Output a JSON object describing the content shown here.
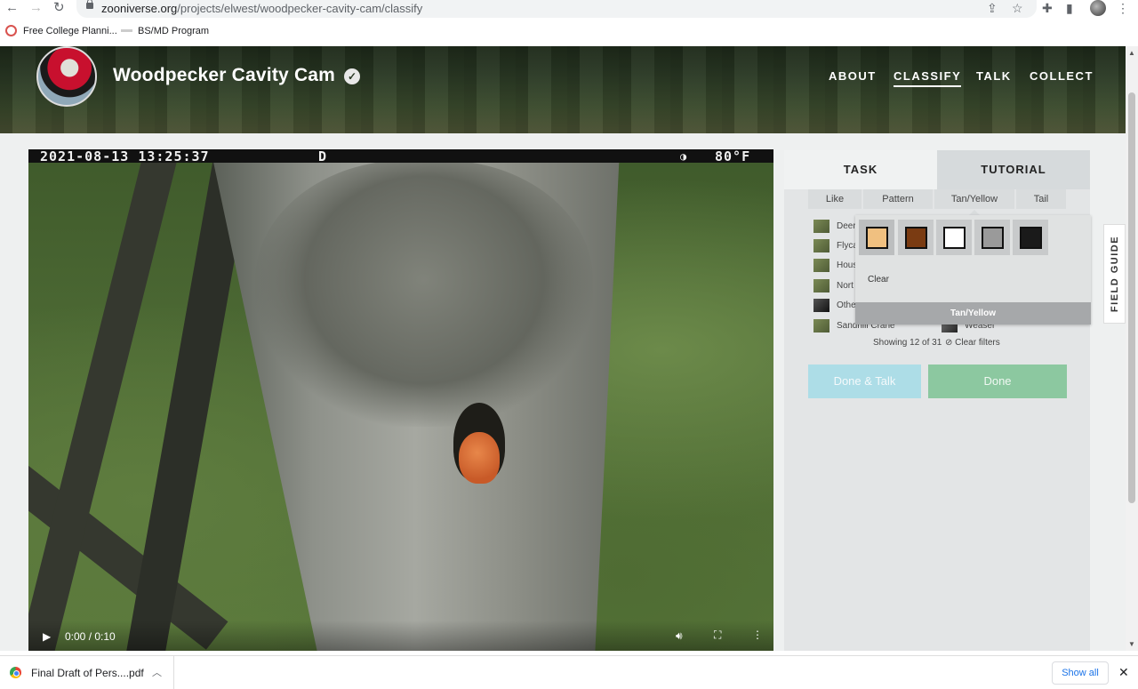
{
  "browser": {
    "url_host": "zooniverse.org",
    "url_path": "/projects/elwest/woodpecker-cavity-cam/classify",
    "bookmarks": [
      {
        "label": "Free College Planni..."
      },
      {
        "label": "BS/MD Program"
      }
    ]
  },
  "header": {
    "title": "Woodpecker Cavity Cam",
    "nav": [
      "ABOUT",
      "CLASSIFY",
      "TALK",
      "COLLECT"
    ],
    "active_nav": "CLASSIFY"
  },
  "video": {
    "timestamp": "2021-08-13 13:25:37",
    "mode": "D",
    "temperature": "80°F",
    "time": "0:00 / 0:10"
  },
  "panel": {
    "tabs": [
      "TASK",
      "TUTORIAL"
    ],
    "filters": [
      "Like",
      "Pattern",
      "Tan/Yellow",
      "Tail"
    ],
    "choices_left": [
      "Deer",
      "Flyca",
      "Hous",
      "Nort",
      "Othe",
      "Sandhill Crane"
    ],
    "choices_right": [
      "Weasel"
    ],
    "showing": "Showing 12 of 31",
    "clear_filters": "Clear filters",
    "done_talk": "Done & Talk",
    "done": "Done",
    "field_guide": "FIELD GUIDE"
  },
  "popup": {
    "swatch_colors": [
      "#f0c080",
      "#7a3b12",
      "#ffffff",
      "#9a9a9a",
      "#1a1a1a"
    ],
    "clear": "Clear",
    "footer": "Tan/Yellow"
  },
  "downloads": {
    "file": "Final Draft of Pers....pdf",
    "show_all": "Show all"
  }
}
